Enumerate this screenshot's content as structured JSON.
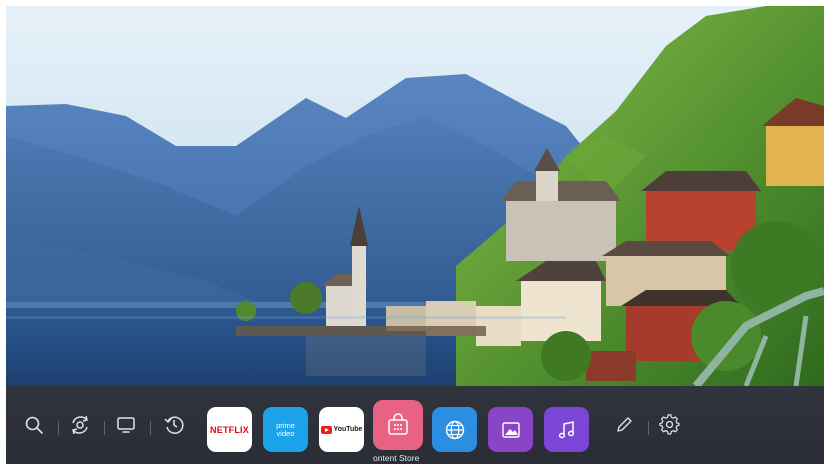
{
  "launcher": {
    "apps": [
      {
        "name": "Netflix",
        "tile_text": "NETFLIX",
        "bg": "#ffffff",
        "fg": "#e50914"
      },
      {
        "name": "Prime Video",
        "tile_text_line1": "prime",
        "tile_text_line2": "video",
        "bg": "#1aa3e8",
        "fg": "#ffffff"
      },
      {
        "name": "YouTube",
        "tile_text": "YouTube",
        "bg": "#ffffff",
        "fg": "#222222"
      },
      {
        "name": "Content Store",
        "bg": "#e86383",
        "fg": "#ffffff"
      },
      {
        "name": "Web Browser",
        "bg": "#2c8ee0",
        "fg": "#ffffff"
      },
      {
        "name": "Gallery",
        "bg": "#8a44c8",
        "fg": "#ffffff"
      },
      {
        "name": "Music",
        "bg": "#7b45d6",
        "fg": "#ffffff"
      }
    ],
    "focused_label": "ontent Store",
    "left_icons": [
      "search-icon",
      "camera-rotate-icon",
      "tv-input-icon",
      "history-icon"
    ],
    "right_icons": [
      "edit-icon",
      "gear-icon"
    ],
    "colors": {
      "bar": "#2d3038",
      "icon": "#e2e2e6",
      "separator": "#5f6470"
    }
  }
}
